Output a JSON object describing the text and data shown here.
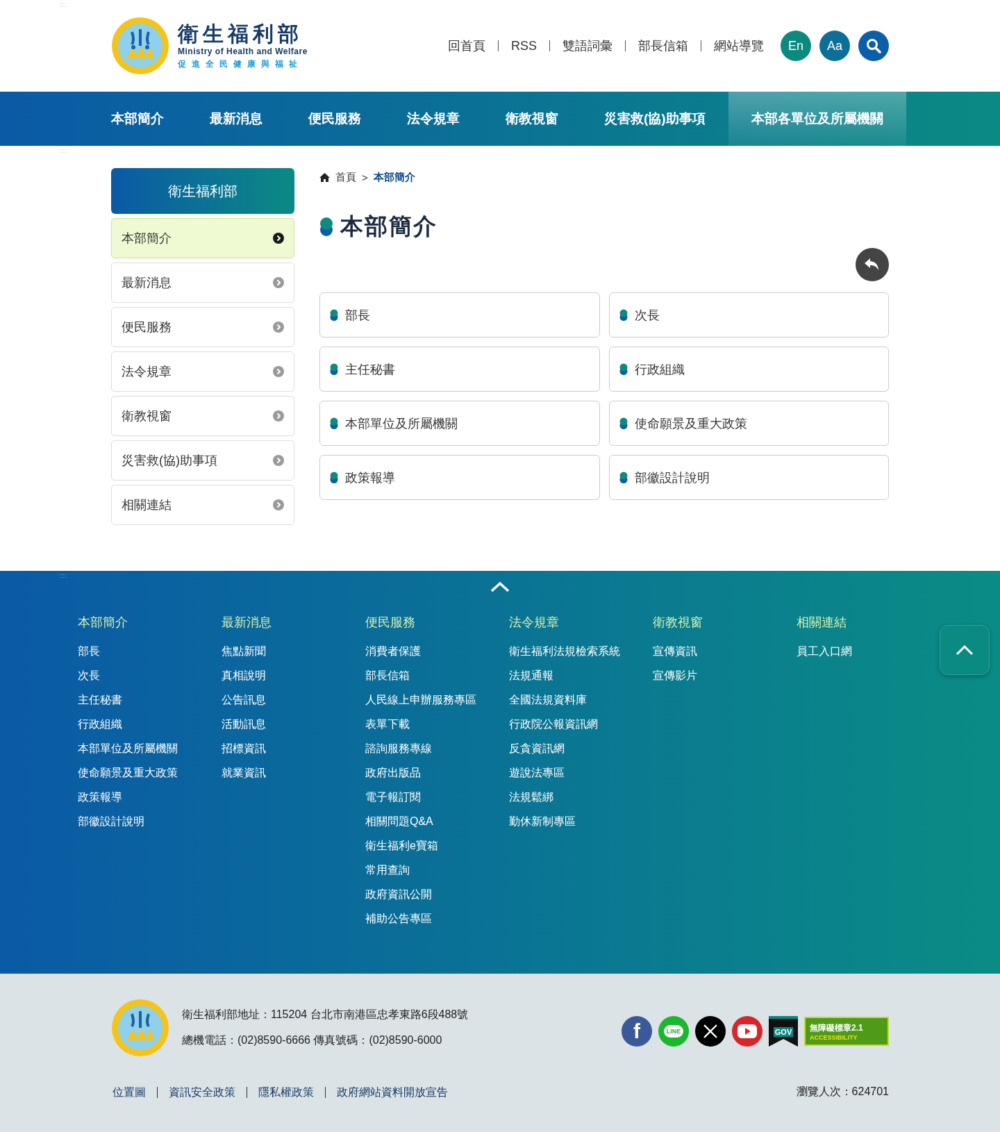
{
  "header": {
    "accesskey": ":::",
    "logo": {
      "title": "衛生福利部",
      "subtitle": "Ministry of Health and Welfare",
      "slogan": "促進全民健康與福祉"
    },
    "links": [
      "回首頁",
      "RSS",
      "雙語詞彙",
      "部長信箱",
      "網站導覽"
    ],
    "buttons": [
      {
        "kind": "text",
        "label": "En",
        "color": "#0d8a80"
      },
      {
        "kind": "text",
        "label": "Aa",
        "color": "#0b6f98"
      },
      {
        "kind": "search",
        "color": "#0b5ea8"
      }
    ]
  },
  "nav": [
    {
      "label": "本部簡介",
      "selected": false
    },
    {
      "label": "最新消息",
      "selected": false
    },
    {
      "label": "便民服務",
      "selected": false
    },
    {
      "label": "法令規章",
      "selected": false
    },
    {
      "label": "衛教視窗",
      "selected": false
    },
    {
      "label": "災害救(協)助事項",
      "selected": false
    },
    {
      "label": "本部各單位及所屬機關",
      "selected": true
    }
  ],
  "main": {
    "accesskey": ":::"
  },
  "sidebar": {
    "title": "衛生福利部",
    "items": [
      {
        "label": "本部簡介",
        "selected": true
      },
      {
        "label": "最新消息",
        "selected": false
      },
      {
        "label": "便民服務",
        "selected": false
      },
      {
        "label": "法令規章",
        "selected": false
      },
      {
        "label": "衛教視窗",
        "selected": false
      },
      {
        "label": "災害救(協)助事項",
        "selected": false
      },
      {
        "label": "相關連結",
        "selected": false
      }
    ]
  },
  "breadcrumb": {
    "items": [
      "首頁",
      "本部簡介"
    ],
    "separator": ">"
  },
  "page_title": "本部簡介",
  "cards": [
    "部長",
    "次長",
    "主任秘書",
    "行政組織",
    "本部單位及所屬機關",
    "使命願景及重大政策",
    "政策報導",
    "部徽設計說明"
  ],
  "footer_nav": {
    "accesskey": ":::",
    "columns": [
      {
        "heading": "本部簡介",
        "links": [
          "部長",
          "次長",
          "主任秘書",
          "行政組織",
          "本部單位及所屬機關",
          "使命願景及重大政策",
          "政策報導",
          "部徽設計說明"
        ]
      },
      {
        "heading": "最新消息",
        "links": [
          "焦點新聞",
          "真相說明",
          "公告訊息",
          "活動訊息",
          "招標資訊",
          "就業資訊"
        ]
      },
      {
        "heading": "便民服務",
        "links": [
          "消費者保護",
          "部長信箱",
          "人民線上申辦服務專區",
          "表單下載",
          "諮詢服務專線",
          "政府出版品",
          "電子報訂閱",
          "相關問題Q&A",
          "衛生福利e寶箱",
          "常用查詢",
          "政府資訊公開",
          "補助公告專區"
        ]
      },
      {
        "heading": "法令規章",
        "links": [
          "衛生福利法規檢索系統",
          "法規通報",
          "全國法規資料庫",
          "行政院公報資訊網",
          "反貪資訊網",
          "遊說法專區",
          "法規鬆綁",
          "勤休新制專區"
        ]
      },
      {
        "heading": "衛教視窗",
        "links": [
          "宣傳資訊",
          "宣傳影片"
        ]
      },
      {
        "heading": "相關連結",
        "links": [
          "員工入口網"
        ]
      }
    ]
  },
  "footer": {
    "address": "衛生福利部地址：115204 台北市南港區忠孝東路6段488號",
    "phone": "總機電話：(02)8590-6666 傳真號碼：(02)8590-6000",
    "social": [
      {
        "kind": "facebook",
        "label": "f",
        "color": "#3b5998"
      },
      {
        "kind": "line",
        "label": "LINE",
        "color": "#19b82e"
      },
      {
        "kind": "x",
        "color": "#000000"
      },
      {
        "kind": "youtube",
        "color": "#d9252a"
      },
      {
        "kind": "gov",
        "label": "GOV"
      },
      {
        "kind": "accessibility",
        "label": "無障礙標章2.1",
        "sublabel": "ACCESSIBILITY"
      }
    ],
    "links": [
      "位置圖",
      "資訊安全政策",
      "隱私權政策",
      "政府網站資料開放宣告"
    ],
    "visits": "瀏覽人次：624701"
  }
}
